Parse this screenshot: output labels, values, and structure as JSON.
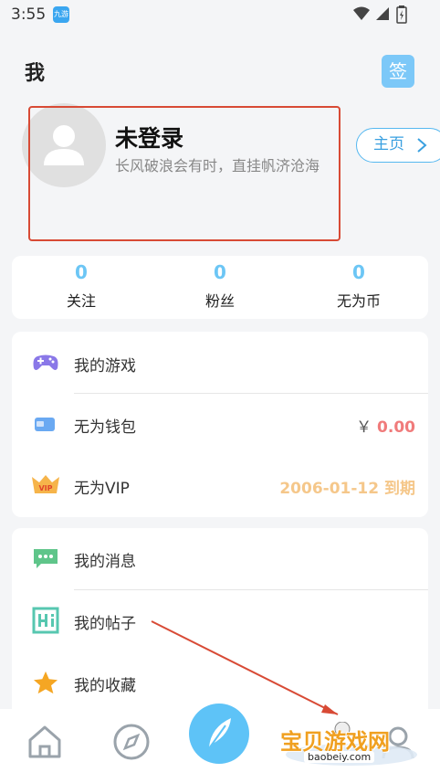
{
  "status_bar": {
    "time": "3:55",
    "app_badge": "九游"
  },
  "header": {
    "title": "我",
    "sign_label": "签"
  },
  "profile": {
    "username": "未登录",
    "motto": "长风破浪会有时，直挂帆济沧海",
    "home_button": "主页"
  },
  "stats": [
    {
      "value": "0",
      "label": "关注"
    },
    {
      "value": "0",
      "label": "粉丝"
    },
    {
      "value": "0",
      "label": "无为币"
    }
  ],
  "menu_group1": [
    {
      "label": "我的游戏",
      "icon": "gamepad-icon"
    },
    {
      "label": "无为钱包",
      "icon": "wallet-icon",
      "currency": "￥",
      "value": "0.00"
    },
    {
      "label": "无为VIP",
      "icon": "vip-icon",
      "value": "2006-01-12 到期"
    }
  ],
  "menu_group2": [
    {
      "label": "我的消息",
      "icon": "message-icon"
    },
    {
      "label": "我的帖子",
      "icon": "post-icon"
    },
    {
      "label": "我的收藏",
      "icon": "star-icon"
    }
  ],
  "tabs": [
    "home-icon",
    "discover-icon",
    "feather-icon",
    "profile-icon"
  ],
  "watermark": {
    "text": "宝贝游戏网",
    "url": "baobeiy.com"
  },
  "colors": {
    "accent": "#5ec3f7",
    "price": "#f07b7b",
    "vip": "#f5c78a",
    "annotation": "#d84a35"
  }
}
